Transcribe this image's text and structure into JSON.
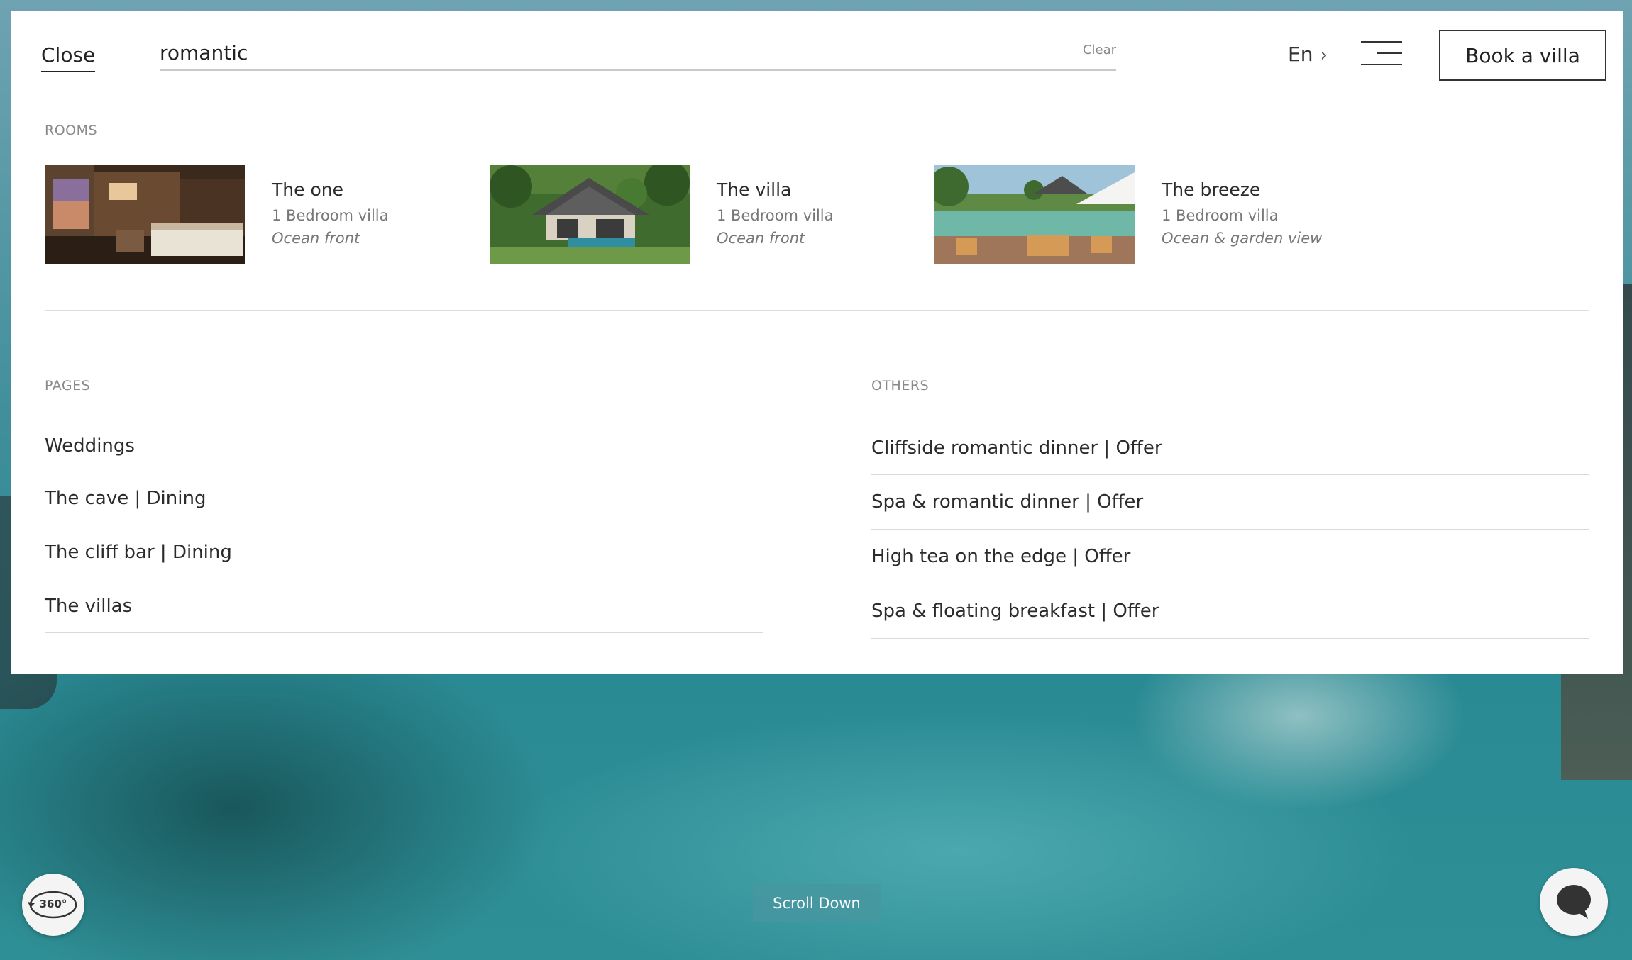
{
  "header": {
    "close_label": "Close",
    "search_value": "romantic",
    "clear_label": "Clear",
    "language": "En",
    "book_label": "Book a villa"
  },
  "rooms": {
    "label": "ROOMS",
    "items": [
      {
        "name": "The one",
        "type": "1 Bedroom villa",
        "view": "Ocean front"
      },
      {
        "name": "The villa",
        "type": "1 Bedroom villa",
        "view": "Ocean front"
      },
      {
        "name": "The breeze",
        "type": "1 Bedroom villa",
        "view": "Ocean & garden view"
      }
    ]
  },
  "pages": {
    "label": "PAGES",
    "items": [
      "Weddings",
      "The cave | Dining",
      "The cliff bar | Dining",
      "The villas"
    ]
  },
  "others": {
    "label": "OTHERS",
    "items": [
      "Cliffside romantic dinner | Offer",
      "Spa & romantic dinner | Offer",
      "High tea on the edge | Offer",
      "Spa & floating breakfast | Offer"
    ]
  },
  "controls": {
    "view_360_label": "360°",
    "scroll_down_label": "Scroll Down"
  },
  "icons": {
    "language_chevron": "chevron-right-icon",
    "menu": "hamburger-menu-icon",
    "view_360": "360-view-icon",
    "chat": "chat-bubble-icon"
  }
}
